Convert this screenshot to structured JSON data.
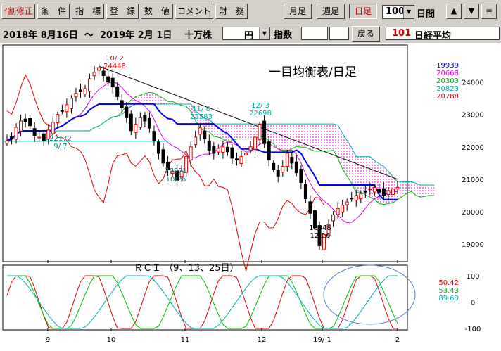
{
  "toolbar": {
    "buttons": [
      "ｲ割修正",
      "条　件",
      "指　標",
      "登　録",
      "数　値",
      "コメント",
      "財　務"
    ],
    "period_buttons": [
      "月足",
      "週足",
      "日足"
    ],
    "bar_count": "100",
    "bar_unit": "日間",
    "nav": [
      "▲",
      "▼",
      "≡"
    ]
  },
  "rangebar": {
    "start_date": "2018年  8月16日",
    "tilde": "〜",
    "end_date": "2019年  2月  1日",
    "unit": "十万株",
    "currency": "円",
    "index_label": "指数",
    "back_button": "戻る",
    "code": "101",
    "name": "日経平均"
  },
  "chart_data": {
    "type": "candlestick",
    "title": "一目均衡表/日足",
    "y_range": [
      18500,
      25100
    ],
    "y_ticks": [
      19000,
      20000,
      21000,
      22000,
      23000,
      24000
    ],
    "x_labels": [
      "9",
      "10",
      "11",
      "12",
      "19/ 1",
      "2"
    ],
    "ichimoku_legend": [
      {
        "value": "19939",
        "color": "#0000ff"
      },
      {
        "value": "20668",
        "color": "#e000e0"
      },
      {
        "value": "20303",
        "color": "#00c000"
      },
      {
        "value": "20823",
        "color": "#00b0b0"
      },
      {
        "value": "20788",
        "color": "#e00000"
      }
    ],
    "annotations": [
      {
        "text": "10/ 2",
        "color": "#e00000"
      },
      {
        "text": "24448",
        "color": "#e00000"
      },
      {
        "text": "22172",
        "color": "#008080"
      },
      {
        "text": "9/ 7",
        "color": "#008080"
      },
      {
        "text": "11/ 8",
        "color": "#00b0b0"
      },
      {
        "text": "22583",
        "color": "#00b0b0"
      },
      {
        "text": "12/ 3",
        "color": "#00b0b0"
      },
      {
        "text": "22698",
        "color": "#00b0b0"
      },
      {
        "text": "20971",
        "color": "#008080"
      },
      {
        "text": "10/26",
        "color": "#008080"
      },
      {
        "text": "18948",
        "color": "#000000"
      },
      {
        "text": "12/26",
        "color": "#000000"
      }
    ],
    "close_approx": [
      22190,
      22270,
      22600,
      22800,
      22780,
      22650,
      22350,
      22300,
      22200,
      22520,
      22760,
      23000,
      23100,
      23300,
      23500,
      23650,
      23700,
      23800,
      24100,
      24300,
      24448,
      24200,
      24000,
      23850,
      23550,
      23200,
      22900,
      22500,
      22700,
      22900,
      22800,
      22580,
      22200,
      21800,
      21500,
      21300,
      21250,
      20971,
      21250,
      21700,
      22000,
      22300,
      22583,
      22250,
      21900,
      21800,
      21950,
      22000,
      21850,
      21650,
      21600,
      21700,
      21800,
      22000,
      22300,
      22698,
      22100,
      21600,
      21300,
      21100,
      21400,
      21800,
      21500,
      21200,
      20900,
      20400,
      19950,
      19500,
      18948,
      19300,
      19600,
      19900,
      20100,
      20200,
      20300,
      20400,
      20500,
      20550,
      20600,
      20700,
      20750,
      20600,
      20500,
      20650,
      20700,
      20750
    ],
    "rci": {
      "label": "ＲＣＩ （9、13、25日）",
      "y_range": [
        -100,
        100
      ],
      "y_ticks": [
        100,
        0,
        -100
      ],
      "legend": [
        {
          "value": "50.42",
          "color": "#e00000"
        },
        {
          "value": "53.43",
          "color": "#00c000"
        },
        {
          "value": "89.63",
          "color": "#00b0b0"
        }
      ]
    }
  }
}
